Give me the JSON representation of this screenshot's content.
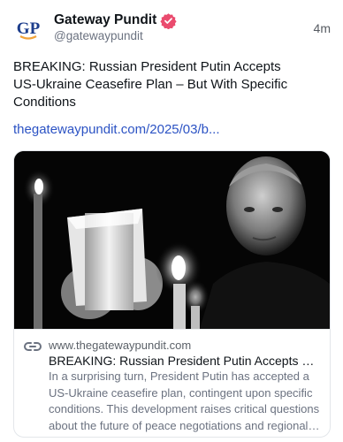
{
  "account": {
    "display_name": "Gateway Pundit",
    "handle": "@gatewaypundit",
    "avatar_text": "GP",
    "verified": true,
    "verified_color": "#ea4b6e"
  },
  "post": {
    "time": "4m",
    "text": "BREAKING: Russian President Putin Accepts US-Ukraine Ceasefire Plan – But With Specific Conditions",
    "link_text": "thegatewaypundit.com/2025/03/b...",
    "link_color": "#2c53c4"
  },
  "card": {
    "image_description_icon": "photo",
    "icon": "link-icon",
    "domain": "www.thegatewaypundit.com",
    "title": "BREAKING: Russian President Putin Accepts U...",
    "description_lines": [
      "In a surprising turn, President Putin has accepted a",
      "US-Ukraine ceasefire plan, contingent upon specific",
      "conditions. This development raises critical questions",
      "about the future of peace negotiations and regional st..."
    ]
  }
}
